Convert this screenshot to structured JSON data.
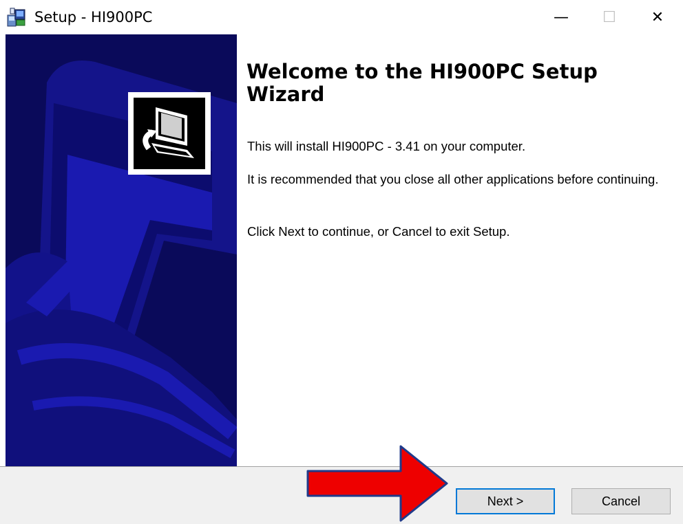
{
  "window": {
    "title": "Setup - HI900PC",
    "minimize_glyph": "—",
    "maximize_glyph": "☐",
    "close_glyph": "✕"
  },
  "content": {
    "heading": "Welcome to the HI900PC Setup Wizard",
    "paragraphs": [
      "This will install HI900PC - 3.41 on your computer.",
      "It is recommended that you close all other applications before continuing.",
      "Click Next to continue, or Cancel to exit Setup."
    ]
  },
  "buttons": {
    "next": "Next >",
    "cancel": "Cancel"
  },
  "icons": {
    "app": "setup-installer-icon",
    "logo": "computer-install-icon",
    "annotation": "red-arrow-icon"
  },
  "colors": {
    "sidebar": "#0a0a5a",
    "sidebar_art": "#1a1ab0",
    "annotation_arrow": "#ee0000",
    "focus_border": "#0078d7"
  }
}
